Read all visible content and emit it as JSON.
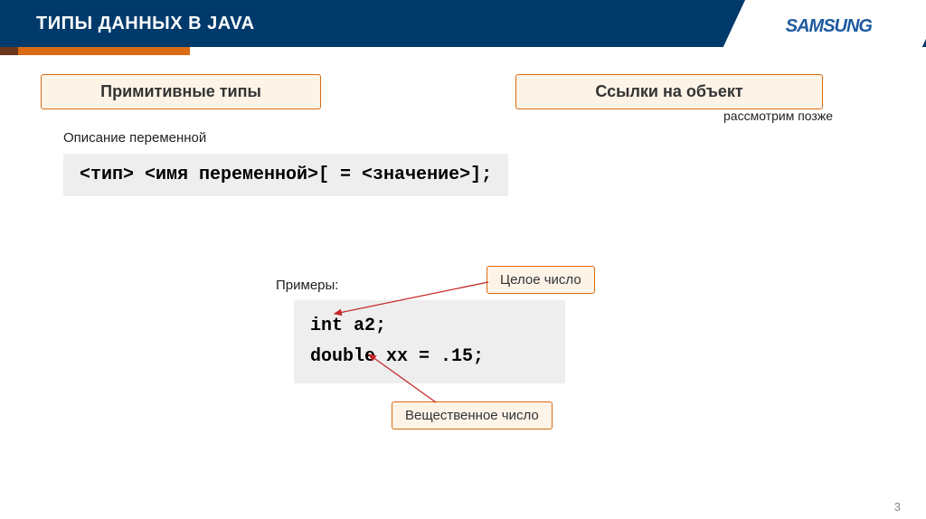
{
  "topbar": {
    "title": "ТИПЫ ДАННЫХ В JAVA",
    "logo": "SAMSUNG"
  },
  "ribbon": {
    "left": "Примитивные типы",
    "right": "Ссылки на объект"
  },
  "note_right": "рассмотрим позже",
  "desc_label": "Описание переменной",
  "code1": "<тип> <имя переменной>[ = <значение>];",
  "examples_label": "Примеры:",
  "code2_line1": "int a2;",
  "code2_line2": "double xx = .15;",
  "annot": {
    "integer": "Целое число",
    "real": "Вещественное число"
  },
  "page_num": "3"
}
